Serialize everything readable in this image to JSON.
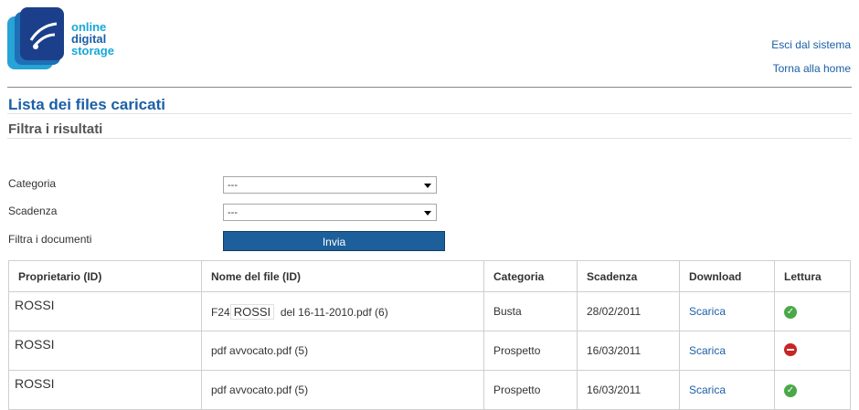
{
  "logo": {
    "line1": "online",
    "line2": "digital",
    "line3": "storage"
  },
  "nav": {
    "logout": "Esci dal sistema",
    "home": "Torna alla home"
  },
  "page": {
    "title": "Lista dei files caricati",
    "subtitle": "Filtra i risultati"
  },
  "filters": {
    "categoria_label": "Categoria",
    "categoria_value": "---",
    "scadenza_label": "Scadenza",
    "scadenza_value": "---",
    "filtra_label": "Filtra i documenti",
    "submit_label": "Invia"
  },
  "table": {
    "headers": [
      "Proprietario (ID)",
      "Nome del file (ID)",
      "Categoria",
      "Scadenza",
      "Download",
      "Lettura"
    ],
    "rows": [
      {
        "owner": "ROSSI",
        "file_prefix": "F24",
        "file_owner": "ROSSI",
        "file_suffix": "del 16-11-2010.pdf (6)",
        "category": "Busta",
        "due": "28/02/2011",
        "download": "Scarica",
        "read_icon": "check-icon",
        "read_color": "#4aa84a"
      },
      {
        "owner": "ROSSI",
        "file": "pdf avvocato.pdf (5)",
        "category": "Prospetto",
        "due": "16/03/2011",
        "download": "Scarica",
        "read_icon": "minus-icon",
        "read_color": "#c82525"
      },
      {
        "owner": "ROSSI",
        "file": "pdf avvocato.pdf (5)",
        "category": "Prospetto",
        "due": "16/03/2011",
        "download": "Scarica",
        "read_icon": "check-icon",
        "read_color": "#4aa84a"
      }
    ]
  },
  "colors": {
    "accent": "#1b5fa6",
    "button": "#1d5f9a",
    "logo_light": "#17a7d8"
  }
}
